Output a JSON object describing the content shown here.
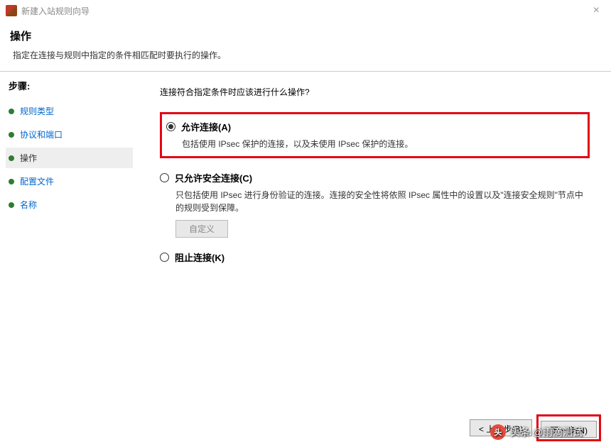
{
  "titlebar": {
    "title": "新建入站规则向导",
    "close": "×"
  },
  "header": {
    "title": "操作",
    "subtitle": "指定在连接与规则中指定的条件相匹配时要执行的操作。"
  },
  "sidebar": {
    "title": "步骤:",
    "items": [
      {
        "label": "规则类型"
      },
      {
        "label": "协议和端口"
      },
      {
        "label": "操作"
      },
      {
        "label": "配置文件"
      },
      {
        "label": "名称"
      }
    ]
  },
  "content": {
    "question": "连接符合指定条件时应该进行什么操作?",
    "options": [
      {
        "label": "允许连接(A)",
        "desc": "包括使用 IPsec 保护的连接，以及未使用 IPsec 保护的连接。"
      },
      {
        "label": "只允许安全连接(C)",
        "desc": "只包括使用 IPsec 进行身份验证的连接。连接的安全性将依照 IPsec 属性中的设置以及\"连接安全规则\"节点中的规则受到保障。",
        "custom_btn": "自定义"
      },
      {
        "label": "阻止连接(K)"
      }
    ]
  },
  "footer": {
    "back": "< 上一步(B)",
    "next": "下一步(N)"
  },
  "watermark": {
    "text": "头条 @雨滴测试"
  }
}
